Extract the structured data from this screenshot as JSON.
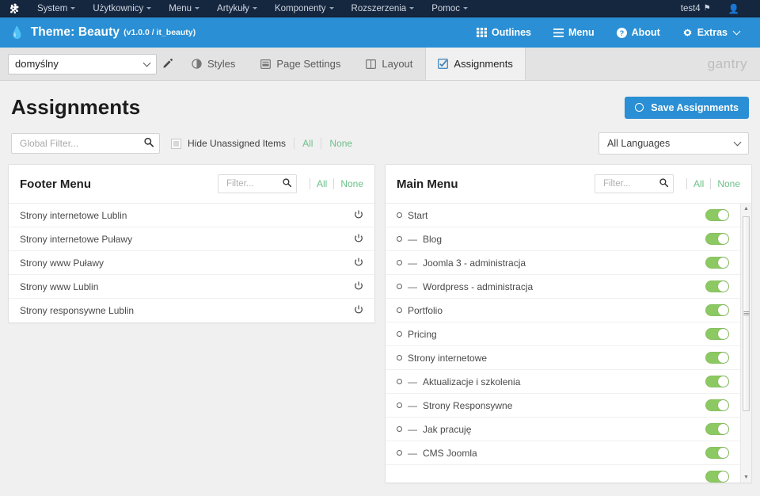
{
  "admin_bar": {
    "logo_icon": "joomla-logo-icon",
    "menu": [
      {
        "label": "System",
        "caret": true
      },
      {
        "label": "Użytkownicy",
        "caret": true
      },
      {
        "label": "Menu",
        "caret": true
      },
      {
        "label": "Artykuły",
        "caret": true
      },
      {
        "label": "Komponenty",
        "caret": true
      },
      {
        "label": "Rozszerzenia",
        "caret": true
      },
      {
        "label": "Pomoc",
        "caret": true
      }
    ],
    "site_name": "test4",
    "site_icon": "external-link-icon",
    "user_icon": "user-icon"
  },
  "theme_bar": {
    "droplet_icon": "droplet-icon",
    "title": "Theme: Beauty",
    "version": "(v1.0.0 / it_beauty)",
    "nav": [
      {
        "label": "Outlines",
        "icon": "grid-icon"
      },
      {
        "label": "Menu",
        "icon": "hamburger-icon"
      },
      {
        "label": "About",
        "icon": "question-circle-icon"
      },
      {
        "label": "Extras",
        "icon": "gear-icon",
        "chevron": true
      }
    ]
  },
  "tabbar": {
    "outline_value": "domyślny",
    "edit_icon": "pencil-icon",
    "tabs": [
      {
        "label": "Styles",
        "icon": "contrast-icon",
        "active": false
      },
      {
        "label": "Page Settings",
        "icon": "page-icon",
        "active": false
      },
      {
        "label": "Layout",
        "icon": "layout-icon",
        "active": false
      },
      {
        "label": "Assignments",
        "icon": "checkbox-icon",
        "active": true
      }
    ],
    "brand": "gantry"
  },
  "page": {
    "title": "Assignments",
    "save_label": "Save Assignments",
    "save_icon": "circle-icon",
    "save_color": "#2a8fd4"
  },
  "filter_row": {
    "global_filter_placeholder": "Global Filter...",
    "global_filter_value": "",
    "search_icon": "search-icon",
    "hide_unassigned_label": "Hide Unassigned Items",
    "hide_unassigned_checked": false,
    "all_label": "All",
    "none_label": "None",
    "language_value": "All Languages",
    "link_color": "#6cc08a"
  },
  "cards": [
    {
      "title": "Footer Menu",
      "filter_placeholder": "Filter...",
      "filter_value": "",
      "all_label": "All",
      "none_label": "None",
      "scrollable": false,
      "rows": [
        {
          "label": "Strony internetowe Lublin",
          "prefix": "",
          "bullet": false,
          "control": "power",
          "on": false
        },
        {
          "label": "Strony internetowe Puławy",
          "prefix": "",
          "bullet": false,
          "control": "power",
          "on": false
        },
        {
          "label": "Strony www Puławy",
          "prefix": "",
          "bullet": false,
          "control": "power",
          "on": false
        },
        {
          "label": "Strony www Lublin",
          "prefix": "",
          "bullet": false,
          "control": "power",
          "on": false
        },
        {
          "label": "Strony responsywne Lublin",
          "prefix": "",
          "bullet": false,
          "control": "power",
          "on": false
        }
      ]
    },
    {
      "title": "Main Menu",
      "filter_placeholder": "Filter...",
      "filter_value": "",
      "all_label": "All",
      "none_label": "None",
      "scrollable": true,
      "rows": [
        {
          "label": "Start",
          "prefix": "",
          "bullet": true,
          "control": "toggle",
          "on": true
        },
        {
          "label": "Blog",
          "prefix": "—",
          "bullet": true,
          "control": "toggle",
          "on": true
        },
        {
          "label": "Joomla 3 - administracja",
          "prefix": "—",
          "bullet": true,
          "control": "toggle",
          "on": true
        },
        {
          "label": "Wordpress - administracja",
          "prefix": "—",
          "bullet": true,
          "control": "toggle",
          "on": true
        },
        {
          "label": "Portfolio",
          "prefix": "",
          "bullet": true,
          "control": "toggle",
          "on": true
        },
        {
          "label": "Pricing",
          "prefix": "",
          "bullet": true,
          "control": "toggle",
          "on": true
        },
        {
          "label": "Strony internetowe",
          "prefix": "",
          "bullet": true,
          "control": "toggle",
          "on": true
        },
        {
          "label": "Aktualizacje i szkolenia",
          "prefix": "—",
          "bullet": true,
          "control": "toggle",
          "on": true
        },
        {
          "label": "Strony Responsywne",
          "prefix": "—",
          "bullet": true,
          "control": "toggle",
          "on": true
        },
        {
          "label": "Jak pracuję",
          "prefix": "—",
          "bullet": true,
          "control": "toggle",
          "on": true
        },
        {
          "label": "CMS Joomla",
          "prefix": "—",
          "bullet": true,
          "control": "toggle",
          "on": true
        }
      ],
      "toggle_color": "#8dc963"
    }
  ]
}
